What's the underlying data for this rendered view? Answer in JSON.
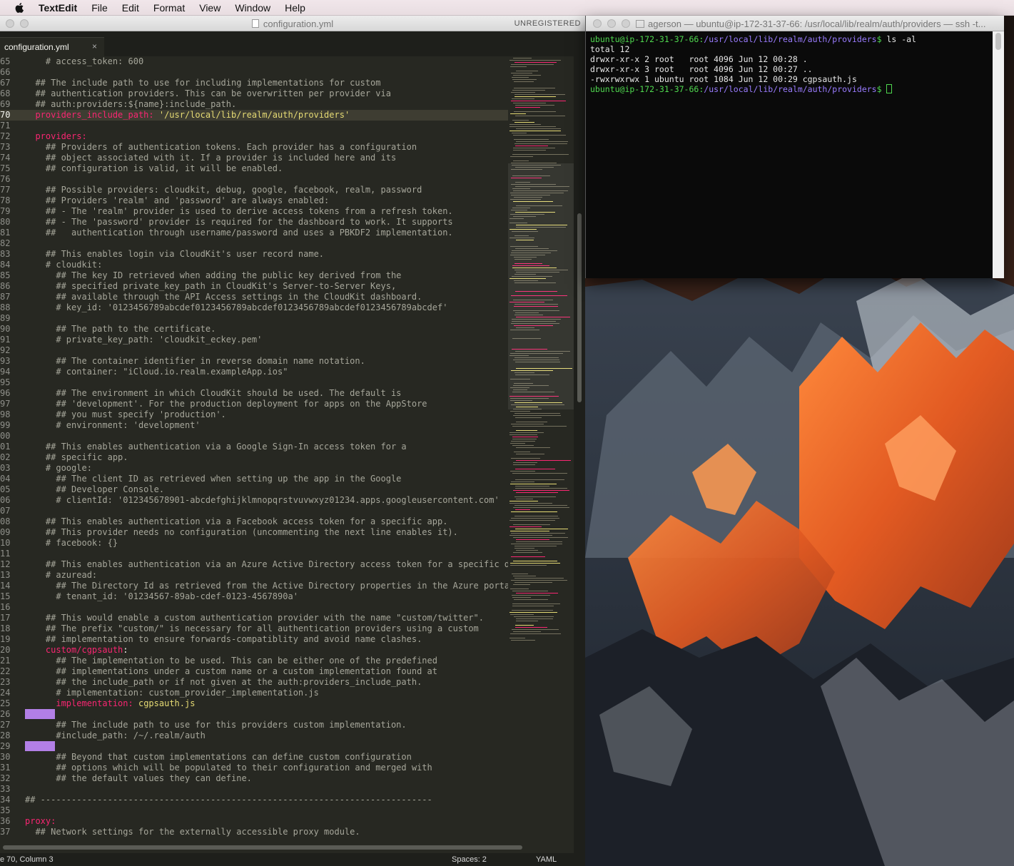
{
  "menubar": {
    "app_name": "TextEdit",
    "items": [
      "File",
      "Edit",
      "Format",
      "View",
      "Window",
      "Help"
    ]
  },
  "editor": {
    "title": "configuration.yml",
    "unregistered": "UNREGISTERED",
    "tab_label": "configuration.yml",
    "tab_close": "×",
    "status": {
      "position": "e 70, Column 3",
      "spaces": "Spaces: 2",
      "syntax": "YAML"
    },
    "lines": [
      {
        "n": "65",
        "segs": [
          {
            "t": "    "
          },
          {
            "c": "c",
            "t": "# access_token: 600"
          }
        ]
      },
      {
        "n": "66",
        "segs": [
          {
            "t": ""
          }
        ]
      },
      {
        "n": "67",
        "segs": [
          {
            "t": "  "
          },
          {
            "c": "c",
            "t": "## The include path to use for including implementations for custom"
          }
        ]
      },
      {
        "n": "68",
        "segs": [
          {
            "t": "  "
          },
          {
            "c": "c",
            "t": "## authentication providers. This can be overwritten per provider via"
          }
        ]
      },
      {
        "n": "69",
        "segs": [
          {
            "t": "  "
          },
          {
            "c": "c",
            "t": "## auth:providers:${name}:include_path."
          }
        ]
      },
      {
        "n": "70",
        "cur": true,
        "segs": [
          {
            "t": "  "
          },
          {
            "c": "k",
            "t": "providers_include_path:"
          },
          {
            "t": " "
          },
          {
            "c": "s",
            "t": "'/usr/local/lib/realm/auth/providers'"
          }
        ]
      },
      {
        "n": "71",
        "segs": [
          {
            "t": ""
          }
        ]
      },
      {
        "n": "72",
        "segs": [
          {
            "t": "  "
          },
          {
            "c": "k",
            "t": "providers:"
          }
        ]
      },
      {
        "n": "73",
        "segs": [
          {
            "t": "    "
          },
          {
            "c": "c",
            "t": "## Providers of authentication tokens. Each provider has a configuration"
          }
        ]
      },
      {
        "n": "74",
        "segs": [
          {
            "t": "    "
          },
          {
            "c": "c",
            "t": "## object associated with it. If a provider is included here and its"
          }
        ]
      },
      {
        "n": "75",
        "segs": [
          {
            "t": "    "
          },
          {
            "c": "c",
            "t": "## configuration is valid, it will be enabled."
          }
        ]
      },
      {
        "n": "76",
        "segs": [
          {
            "t": ""
          }
        ]
      },
      {
        "n": "77",
        "segs": [
          {
            "t": "    "
          },
          {
            "c": "c",
            "t": "## Possible providers: cloudkit, debug, google, facebook, realm, password"
          }
        ]
      },
      {
        "n": "78",
        "segs": [
          {
            "t": "    "
          },
          {
            "c": "c",
            "t": "## Providers 'realm' and 'password' are always enabled:"
          }
        ]
      },
      {
        "n": "79",
        "segs": [
          {
            "t": "    "
          },
          {
            "c": "c",
            "t": "## - The 'realm' provider is used to derive access tokens from a refresh token."
          }
        ]
      },
      {
        "n": "80",
        "segs": [
          {
            "t": "    "
          },
          {
            "c": "c",
            "t": "## - The 'password' provider is required for the dashboard to work. It supports"
          }
        ]
      },
      {
        "n": "81",
        "segs": [
          {
            "t": "    "
          },
          {
            "c": "c",
            "t": "##   authentication through username/password and uses a PBKDF2 implementation."
          }
        ]
      },
      {
        "n": "82",
        "segs": [
          {
            "t": ""
          }
        ]
      },
      {
        "n": "83",
        "segs": [
          {
            "t": "    "
          },
          {
            "c": "c",
            "t": "## This enables login via CloudKit's user record name."
          }
        ]
      },
      {
        "n": "84",
        "segs": [
          {
            "t": "    "
          },
          {
            "c": "c",
            "t": "# cloudkit:"
          }
        ]
      },
      {
        "n": "85",
        "segs": [
          {
            "t": "      "
          },
          {
            "c": "c",
            "t": "## The key ID retrieved when adding the public key derived from the"
          }
        ]
      },
      {
        "n": "86",
        "segs": [
          {
            "t": "      "
          },
          {
            "c": "c",
            "t": "## specified private_key_path in CloudKit's Server-to-Server Keys,"
          }
        ]
      },
      {
        "n": "87",
        "segs": [
          {
            "t": "      "
          },
          {
            "c": "c",
            "t": "## available through the API Access settings in the CloudKit dashboard."
          }
        ]
      },
      {
        "n": "88",
        "segs": [
          {
            "t": "      "
          },
          {
            "c": "c",
            "t": "# key_id: '0123456789abcdef0123456789abcdef0123456789abcdef0123456789abcdef'"
          }
        ]
      },
      {
        "n": "89",
        "segs": [
          {
            "t": ""
          }
        ]
      },
      {
        "n": "90",
        "segs": [
          {
            "t": "      "
          },
          {
            "c": "c",
            "t": "## The path to the certificate."
          }
        ]
      },
      {
        "n": "91",
        "segs": [
          {
            "t": "      "
          },
          {
            "c": "c",
            "t": "# private_key_path: 'cloudkit_eckey.pem'"
          }
        ]
      },
      {
        "n": "92",
        "segs": [
          {
            "t": ""
          }
        ]
      },
      {
        "n": "93",
        "segs": [
          {
            "t": "      "
          },
          {
            "c": "c",
            "t": "## The container identifier in reverse domain name notation."
          }
        ]
      },
      {
        "n": "94",
        "segs": [
          {
            "t": "      "
          },
          {
            "c": "c",
            "t": "# container: \"iCloud.io.realm.exampleApp.ios\""
          }
        ]
      },
      {
        "n": "95",
        "segs": [
          {
            "t": ""
          }
        ]
      },
      {
        "n": "96",
        "segs": [
          {
            "t": "      "
          },
          {
            "c": "c",
            "t": "## The environment in which CloudKit should be used. The default is"
          }
        ]
      },
      {
        "n": "97",
        "segs": [
          {
            "t": "      "
          },
          {
            "c": "c",
            "t": "## 'development'. For the production deployment for apps on the AppStore"
          }
        ]
      },
      {
        "n": "98",
        "segs": [
          {
            "t": "      "
          },
          {
            "c": "c",
            "t": "## you must specify 'production'."
          }
        ]
      },
      {
        "n": "99",
        "segs": [
          {
            "t": "      "
          },
          {
            "c": "c",
            "t": "# environment: 'development'"
          }
        ]
      },
      {
        "n": "00",
        "segs": [
          {
            "t": ""
          }
        ]
      },
      {
        "n": "01",
        "segs": [
          {
            "t": "    "
          },
          {
            "c": "c",
            "t": "## This enables authentication via a Google Sign-In access token for a"
          }
        ]
      },
      {
        "n": "02",
        "segs": [
          {
            "t": "    "
          },
          {
            "c": "c",
            "t": "## specific app."
          }
        ]
      },
      {
        "n": "03",
        "segs": [
          {
            "t": "    "
          },
          {
            "c": "c",
            "t": "# google:"
          }
        ]
      },
      {
        "n": "04",
        "segs": [
          {
            "t": "      "
          },
          {
            "c": "c",
            "t": "## The client ID as retrieved when setting up the app in the Google"
          }
        ]
      },
      {
        "n": "05",
        "segs": [
          {
            "t": "      "
          },
          {
            "c": "c",
            "t": "## Developer Console."
          }
        ]
      },
      {
        "n": "06",
        "segs": [
          {
            "t": "      "
          },
          {
            "c": "c",
            "t": "# clientId: '012345678901-abcdefghijklmnopqrstvuvwxyz01234.apps.googleusercontent.com'"
          }
        ]
      },
      {
        "n": "07",
        "segs": [
          {
            "t": ""
          }
        ]
      },
      {
        "n": "08",
        "segs": [
          {
            "t": "    "
          },
          {
            "c": "c",
            "t": "## This enables authentication via a Facebook access token for a specific app."
          }
        ]
      },
      {
        "n": "09",
        "segs": [
          {
            "t": "    "
          },
          {
            "c": "c",
            "t": "## This provider needs no configuration (uncommenting the next line enables it)."
          }
        ]
      },
      {
        "n": "10",
        "segs": [
          {
            "t": "    "
          },
          {
            "c": "c",
            "t": "# facebook: {}"
          }
        ]
      },
      {
        "n": "11",
        "segs": [
          {
            "t": ""
          }
        ]
      },
      {
        "n": "12",
        "segs": [
          {
            "t": "    "
          },
          {
            "c": "c",
            "t": "## This enables authentication via an Azure Active Directory access token for a specific dire"
          }
        ]
      },
      {
        "n": "13",
        "segs": [
          {
            "t": "    "
          },
          {
            "c": "c",
            "t": "# azuread:"
          }
        ]
      },
      {
        "n": "14",
        "segs": [
          {
            "t": "      "
          },
          {
            "c": "c",
            "t": "## The Directory Id as retrieved from the Active Directory properties in the Azure portal."
          }
        ]
      },
      {
        "n": "15",
        "segs": [
          {
            "t": "      "
          },
          {
            "c": "c",
            "t": "# tenant_id: '01234567-89ab-cdef-0123-4567890a'"
          }
        ]
      },
      {
        "n": "16",
        "segs": [
          {
            "t": ""
          }
        ]
      },
      {
        "n": "17",
        "segs": [
          {
            "t": "    "
          },
          {
            "c": "c",
            "t": "## This would enable a custom authentication provider with the name \"custom/twitter\"."
          }
        ]
      },
      {
        "n": "18",
        "segs": [
          {
            "t": "    "
          },
          {
            "c": "c",
            "t": "## The prefix \"custom/\" is necessary for all authentication providers using a custom"
          }
        ]
      },
      {
        "n": "19",
        "segs": [
          {
            "t": "    "
          },
          {
            "c": "c",
            "t": "## implementation to ensure forwards-compatiblity and avoid name clashes."
          }
        ]
      },
      {
        "n": "20",
        "segs": [
          {
            "t": "    "
          },
          {
            "c": "k",
            "t": "custom/cgpsauth"
          },
          {
            "t": ":"
          }
        ]
      },
      {
        "n": "21",
        "segs": [
          {
            "t": "      "
          },
          {
            "c": "c",
            "t": "## The implementation to be used. This can be either one of the predefined"
          }
        ]
      },
      {
        "n": "22",
        "segs": [
          {
            "t": "      "
          },
          {
            "c": "c",
            "t": "## implementations under a custom name or a custom implementation found at"
          }
        ]
      },
      {
        "n": "23",
        "segs": [
          {
            "t": "      "
          },
          {
            "c": "c",
            "t": "## the include_path or if not given at the auth:providers_include_path."
          }
        ]
      },
      {
        "n": "24",
        "segs": [
          {
            "t": "      "
          },
          {
            "c": "c",
            "t": "# implementation: custom_provider_implementation.js"
          }
        ]
      },
      {
        "n": "25",
        "segs": [
          {
            "t": "      "
          },
          {
            "c": "k",
            "t": "implementation:"
          },
          {
            "t": " "
          },
          {
            "c": "s",
            "t": "cgpsauth.js"
          }
        ]
      },
      {
        "n": "26",
        "mark": true,
        "segs": []
      },
      {
        "n": "27",
        "segs": [
          {
            "t": "      "
          },
          {
            "c": "c",
            "t": "## The include path to use for this providers custom implementation."
          }
        ]
      },
      {
        "n": "28",
        "segs": [
          {
            "t": "      "
          },
          {
            "c": "c",
            "t": "#include_path: /~/.realm/auth"
          }
        ]
      },
      {
        "n": "29",
        "mark": true,
        "segs": []
      },
      {
        "n": "30",
        "segs": [
          {
            "t": "      "
          },
          {
            "c": "c",
            "t": "## Beyond that custom implementations can define custom configuration"
          }
        ]
      },
      {
        "n": "31",
        "segs": [
          {
            "t": "      "
          },
          {
            "c": "c",
            "t": "## options which will be populated to their configuration and merged with"
          }
        ]
      },
      {
        "n": "32",
        "segs": [
          {
            "t": "      "
          },
          {
            "c": "c",
            "t": "## the default values they can define."
          }
        ]
      },
      {
        "n": "33",
        "segs": [
          {
            "t": ""
          }
        ]
      },
      {
        "n": "34",
        "segs": [
          {
            "c": "c",
            "t": "## ----------------------------------------------------------------------------"
          }
        ]
      },
      {
        "n": "35",
        "segs": [
          {
            "t": ""
          }
        ]
      },
      {
        "n": "36",
        "segs": [
          {
            "c": "k",
            "t": "proxy:"
          }
        ]
      },
      {
        "n": "37",
        "segs": [
          {
            "t": "  "
          },
          {
            "c": "c",
            "t": "## Network settings for the externally accessible proxy module."
          }
        ]
      }
    ]
  },
  "terminal": {
    "title": "agerson — ubuntu@ip-172-31-37-66: /usr/local/lib/realm/auth/providers — ssh -t...",
    "user_host": "ubuntu@ip-172-31-37-66",
    "path": "/usr/local/lib/realm/auth/providers",
    "command": "ls -al",
    "output": [
      "total 12",
      "drwxr-xr-x 2 root   root 4096 Jun 12 00:28 .",
      "drwxr-xr-x 3 root   root 4096 Jun 12 00:27 ..",
      "-rwxrwxrwx 1 ubuntu root 1084 Jun 12 00:29 cgpsauth.js"
    ]
  },
  "colors": {
    "editor_bg": "#272822",
    "keyword": "#f92672",
    "string": "#e6db74",
    "comment": "#a6a69a",
    "marker": "#b27fe6",
    "term_user": "#4fd84f",
    "term_path": "#9a7cff"
  },
  "icons": [
    "apple-icon",
    "document-icon",
    "home-folder-icon",
    "close-icon",
    "cursor-block-icon"
  ]
}
